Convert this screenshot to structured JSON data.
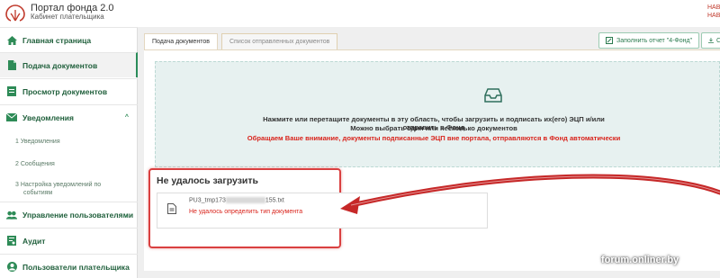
{
  "header": {
    "title": "Портал фонда 2.0",
    "subtitle": "Кабинет плательщика",
    "user_line1": "НАВ",
    "user_line2": "НАВ"
  },
  "sidebar": {
    "items": [
      {
        "label": "Главная страница",
        "icon": "home-icon"
      },
      {
        "label": "Подача документов",
        "icon": "document-icon"
      },
      {
        "label": "Просмотр документов",
        "icon": "folder-icon"
      },
      {
        "label": "Уведомления",
        "icon": "envelope-icon"
      },
      {
        "label": "Управление пользователями",
        "icon": "users-icon"
      },
      {
        "label": "Аудит",
        "icon": "audit-icon"
      },
      {
        "label": "Пользователи плательщика",
        "icon": "user-icon"
      }
    ],
    "sub_items": [
      {
        "label": "1  Уведомления"
      },
      {
        "label": "2  Сообщения"
      },
      {
        "label": "3  Настройка уведомлений по",
        "label2": "событиям"
      }
    ]
  },
  "tabs": [
    {
      "label": "Подача документов"
    },
    {
      "label": "Список отправленных документов"
    }
  ],
  "toolbar": {
    "fill_report_label": "Заполнить отчет \"4-Фонд\"",
    "second_btn_label": "С"
  },
  "dropzone": {
    "line1": "Нажмите или перетащите документы в эту область, чтобы загрузить и подписать их(его) ЭЦП и/или отправить в Фонд",
    "line2": "Можно выбрать один или несколько документов",
    "warning": "Обращаем Ваше внимание, документы подписанные ЭЦП вне портала, отправляются в Фонд автоматически"
  },
  "upload_failed": {
    "title": "Не удалось загрузить",
    "file_name_prefix": "PU3_tmp173",
    "file_name_suffix": "155.txt",
    "error": "Не удалось определить тип документа"
  },
  "watermark": "forum.onliner.by",
  "colors": {
    "brand_green": "#2e8b57",
    "dropzone_bg": "#e7f1f0",
    "error_red": "#d9231b",
    "highlight_red": "#d94040"
  }
}
